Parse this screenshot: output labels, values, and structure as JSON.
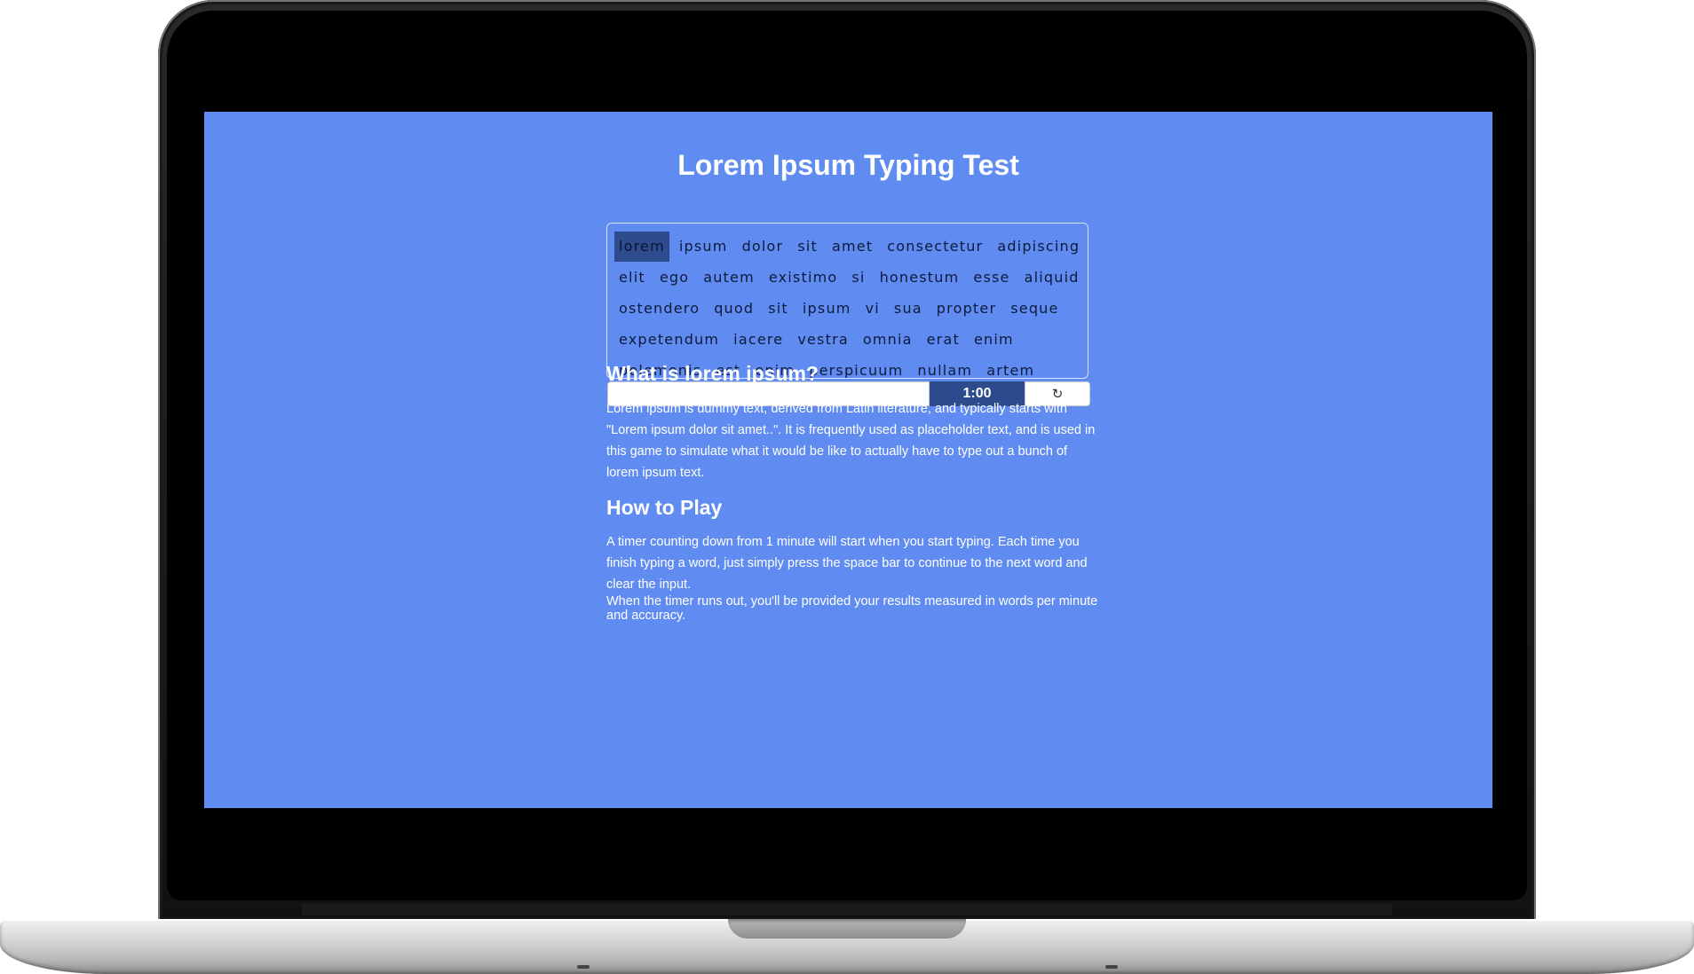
{
  "app": {
    "title": "Lorem Ipsum Typing Test"
  },
  "typing_area": {
    "lines": [
      [
        "lorem",
        "ipsum",
        "dolor",
        "sit",
        "amet",
        "consectetur",
        "adipiscing"
      ],
      [
        "elit",
        "ego",
        "autem",
        "existimo",
        "si",
        "honestum",
        "esse",
        "aliquid"
      ],
      [
        "ostendero",
        "quod",
        "sit",
        "ipsum",
        "vi",
        "sua",
        "propter",
        "seque"
      ],
      [
        "expetendum",
        "iacere",
        "vestra",
        "omnia",
        "erat",
        "enim"
      ],
      [
        "polemonis",
        "est",
        "enim",
        "perspicuum",
        "nullam",
        "artem"
      ]
    ],
    "current_word": "lorem",
    "input_value": "",
    "timer": "1:00",
    "reset_icon": "refresh-icon",
    "reset_glyph": "↻"
  },
  "about": {
    "heading": "What is lorem ipsum?",
    "text": "Lorem ipsum is dummy text, derived from Latin literature, and typically starts with \"Lorem ipsum dolor sit amet..\". It is frequently used as placeholder text, and is used in this game to simulate what it would be like to actually have to type out a bunch of lorem ipsum text."
  },
  "how_to_play": {
    "heading": "How to Play",
    "paragraph_1": "A timer counting down from 1 minute will start when you start typing. Each time you finish typing a word, just simply press the space bar to continue to the next word and clear the input.",
    "paragraph_2": "When the timer runs out, you'll be provided your results measured in words per minute and accuracy."
  },
  "colors": {
    "background": "#608cf2",
    "accent": "#2e4b8d",
    "text": "#ffffff",
    "word_text": "#0d1a3a"
  }
}
